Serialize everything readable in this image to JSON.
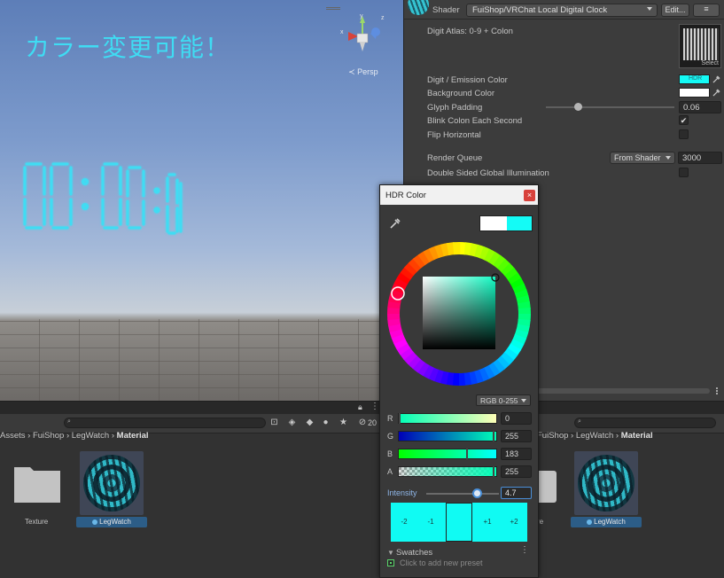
{
  "scene": {
    "title": "カラー変更可能！",
    "clock_text": "00:00:00",
    "persp_label": "Persp",
    "gizmo_labels": {
      "y": "y",
      "x": "x",
      "z": "z"
    }
  },
  "inspector": {
    "shader_label": "Shader",
    "shader_value": "FuiShop/VRChat Local Digital Clock",
    "edit_label": "Edit...",
    "menu_label": "≡",
    "atlas_label": "Digit Atlas: 0-9 + Colon",
    "atlas_select": "Select",
    "digit_color_label": "Digit / Emission Color",
    "hdr_badge": "HDR",
    "background_color_label": "Background Color",
    "glyph_padding_label": "Glyph Padding",
    "glyph_padding_value": "0.06",
    "glyph_padding_fraction": 0.25,
    "blink_label": "Blink Colon Each Second",
    "blink_checked": "✔",
    "flip_label": "Flip Horizontal",
    "render_queue_label": "Render Queue",
    "render_queue_mode": "From Shader",
    "render_queue_value": "3000",
    "double_sided_label": "Double Sided Global Illumination"
  },
  "project_left": {
    "count_badge": "20",
    "breadcrumb": {
      "path": "Assets › FuiShop › LegWatch ›",
      "current": "Material"
    },
    "folder_label": "Texture",
    "asset_label": "LegWatch"
  },
  "project_right": {
    "breadcrumb": {
      "path": "FuiShop › LegWatch ›",
      "current": "Material"
    },
    "folder_label": "re",
    "asset_label": "LegWatch"
  },
  "hdr": {
    "title": "HDR Color",
    "close_label": "×",
    "mode_label": "RGB 0-255",
    "channels": [
      {
        "label": "R",
        "value": "0",
        "fraction": 0.0
      },
      {
        "label": "G",
        "value": "255",
        "fraction": 1.0
      },
      {
        "label": "B",
        "value": "183",
        "fraction": 0.72
      },
      {
        "label": "A",
        "value": "255",
        "fraction": 1.0
      }
    ],
    "intensity_label": "Intensity",
    "intensity_value": "4.7",
    "exposure_steps": [
      "-2",
      "-1",
      "+1",
      "+2"
    ],
    "swatches_label": "Swatches",
    "swatches_menu": "⋮",
    "preset_hint": "Click to add new preset"
  },
  "colors": {
    "accent": "#14fbf6",
    "clock_glow": "#3fdcf3",
    "selection": "#2c5d87"
  }
}
